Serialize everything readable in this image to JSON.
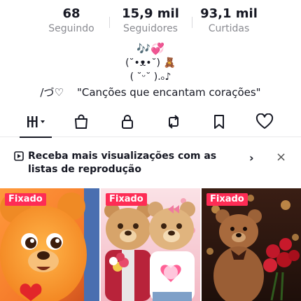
{
  "stats": {
    "following": {
      "value": "68",
      "label": "Seguindo"
    },
    "followers": {
      "value": "15,9 mil",
      "label": "Seguidores"
    },
    "likes": {
      "value": "93,1 mil",
      "label": "Curtidas"
    }
  },
  "bio": {
    "line1": "🎶💞",
    "line2": "(˘•ᴥ•˘) 🧸",
    "line3": "( ˘ᵕ˘ ).ₒ♪",
    "line4": "/づ♡    \"Canções que encantam corações\""
  },
  "tabs": [
    {
      "icon": "grid-videos-icon"
    },
    {
      "icon": "shop-bag-icon"
    },
    {
      "icon": "lock-icon"
    },
    {
      "icon": "repost-icon"
    },
    {
      "icon": "bookmark-icon"
    },
    {
      "icon": "heart-icon"
    }
  ],
  "banner": {
    "text": "Receba mais visualizações com as listas de reprodução",
    "icon": "playlist-icon"
  },
  "videos": [
    {
      "badge": "Fixado"
    },
    {
      "badge": "Fixado"
    },
    {
      "badge": "Fixado"
    }
  ],
  "colors": {
    "accent": "#fe2c55",
    "text": "#161823",
    "muted": "#8a8b91"
  }
}
